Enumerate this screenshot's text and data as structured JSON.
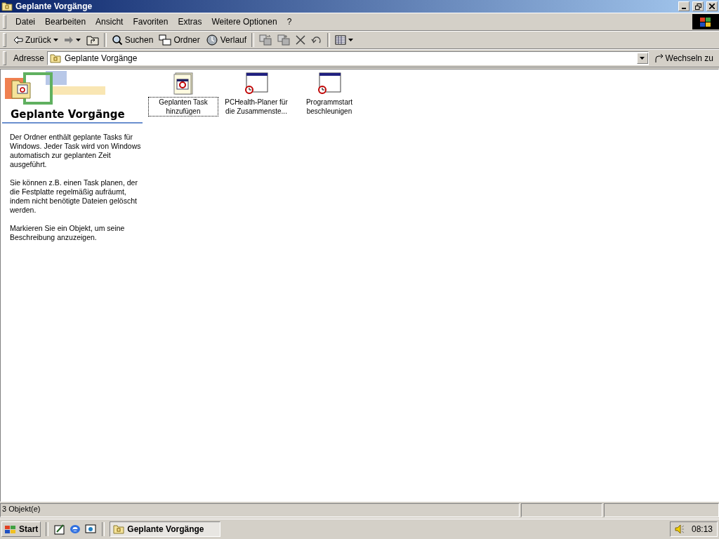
{
  "window": {
    "title": "Geplante Vorgänge"
  },
  "menu": [
    {
      "label": "Datei"
    },
    {
      "label": "Bearbeiten"
    },
    {
      "label": "Ansicht"
    },
    {
      "label": "Favoriten"
    },
    {
      "label": "Extras"
    },
    {
      "label": "Weitere Optionen"
    },
    {
      "label": "?"
    }
  ],
  "toolbar": [
    {
      "kind": "back",
      "label": "Zurück",
      "disabled": false
    },
    {
      "kind": "forward",
      "disabled": true
    },
    {
      "kind": "up"
    },
    {
      "kind": "separator"
    },
    {
      "kind": "search",
      "label": "Suchen"
    },
    {
      "kind": "folders",
      "label": "Ordner"
    },
    {
      "kind": "history",
      "label": "Verlauf"
    },
    {
      "kind": "separator"
    },
    {
      "kind": "move"
    },
    {
      "kind": "copy"
    },
    {
      "kind": "delete"
    },
    {
      "kind": "undo"
    },
    {
      "kind": "separator"
    },
    {
      "kind": "views"
    }
  ],
  "address": {
    "label": "Adresse",
    "value": "Geplante Vorgänge",
    "go_button": "Wechseln zu"
  },
  "info_pane": {
    "title": "Geplante Vorgänge",
    "paragraphs": [
      "Der Ordner enthält geplante Tasks für Windows. Jeder Task wird von Windows automatisch zur geplanten Zeit ausgeführt.",
      "Sie können z.B. einen Task planen, der die Festplatte regelmäßig aufräumt, indem nicht benötigte Dateien gelöscht werden.",
      "Markieren Sie ein Objekt, um seine Beschreibung anzuzeigen."
    ]
  },
  "items": [
    {
      "kind": "add-task",
      "label": "Geplanten Task hinzufügen",
      "focused": true
    },
    {
      "kind": "task",
      "label": "PCHealth-Planer für die Zusammenste...",
      "focused": false
    },
    {
      "kind": "task",
      "label": "Programmstart beschleunigen",
      "focused": false
    }
  ],
  "status_bar": {
    "text": "3 Objekt(e)"
  },
  "taskbar": {
    "start": "Start",
    "tasks": [
      {
        "label": "Geplante Vorgänge",
        "selected": true
      }
    ],
    "clock": "08:13"
  }
}
